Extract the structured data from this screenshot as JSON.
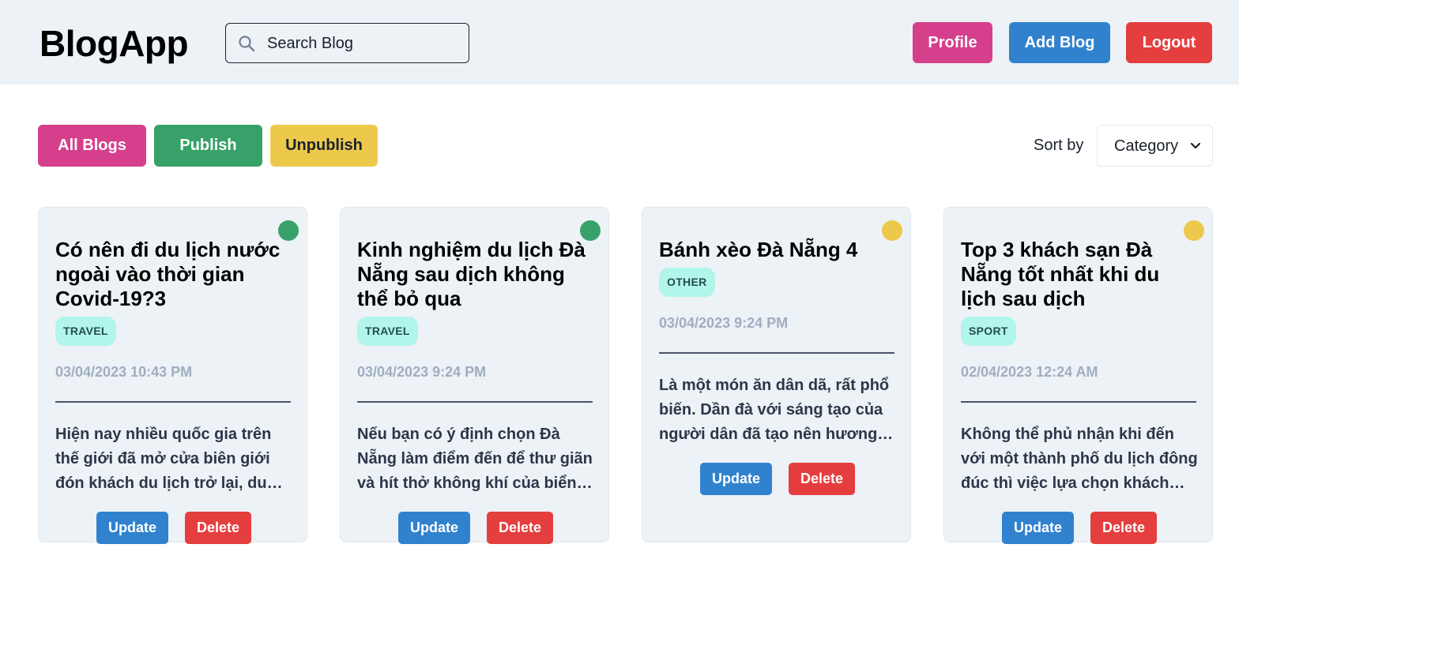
{
  "app": {
    "title": "BlogApp"
  },
  "search": {
    "placeholder": "Search Blog"
  },
  "header_buttons": {
    "profile": "Profile",
    "add_blog": "Add Blog",
    "logout": "Logout"
  },
  "filters": {
    "all": "All Blogs",
    "publish": "Publish",
    "unpublish": "Unpublish"
  },
  "sort": {
    "label": "Sort by",
    "selected": "Category"
  },
  "colors": {
    "published": "#38a169",
    "unpublished": "#ecc94b",
    "accent_pink": "#d53f8c",
    "accent_blue": "#3182ce",
    "accent_red": "#e53e3e"
  },
  "cards": [
    {
      "title": "Có nên đi du lịch nước ngoài vào thời gian Covid-19?3",
      "category": "TRAVEL",
      "date": "03/04/2023 10:43 PM",
      "description": "Hiện nay nhiều quốc gia trên thế giới đã mở cửa biên giới đón khách du lịch trở lại, du khách có thể lên kế hoạch cho chuyến đi của mình",
      "status": "published",
      "update_label": "Update",
      "delete_label": "Delete"
    },
    {
      "title": "Kinh nghiệm du lịch Đà Nẵng sau dịch không thể bỏ qua",
      "category": "TRAVEL",
      "date": "03/04/2023 9:24 PM",
      "description": "Nếu bạn có ý định chọn Đà Nẵng làm điểm đến để thư giãn và hít thở không khí của biển cả trong lành",
      "status": "published",
      "update_label": "Update",
      "delete_label": "Delete"
    },
    {
      "title": "Bánh xèo Đà Nẵng 4",
      "category": "OTHER",
      "date": "03/04/2023 9:24 PM",
      "description": "Là một món ăn dân dã, rất phổ biến. Dần đà với sáng tạo của người dân đã tạo nên hương vị đặc trưng",
      "status": "unpublished",
      "update_label": "Update",
      "delete_label": "Delete"
    },
    {
      "title": "Top 3 khách sạn Đà Nẵng tốt nhất khi du lịch sau dịch",
      "category": "SPORT",
      "date": "02/04/2023 12:24 AM",
      "description": "Không thể phủ nhận khi đến với một thành phố du lịch đông đúc thì việc lựa chọn khách sạn ở Đà Nẵng là điều cần thiết",
      "status": "unpublished",
      "update_label": "Update",
      "delete_label": "Delete"
    }
  ]
}
